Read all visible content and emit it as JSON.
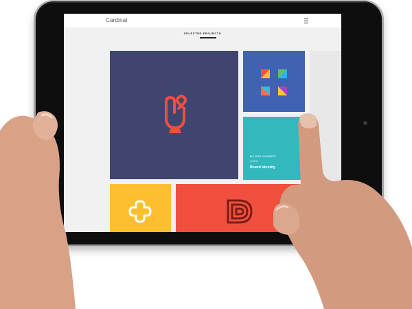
{
  "site": {
    "brand": "Cardinal",
    "menu_icon": "hamburger-menu-icon"
  },
  "section": {
    "title": "SELECTED PROJECTS"
  },
  "projects": [
    {
      "color": "#404570",
      "icon": "lock-logo-icon"
    },
    {
      "color": "#3f63b2",
      "icon": "colorful-tiles-logo-icon"
    },
    {
      "color": "#33b9bd",
      "caption": "W LOGO CONCEPT",
      "title": "Brand Identity"
    },
    {
      "color": "#fcbf2f",
      "icon": "cross-logo-icon"
    },
    {
      "color": "#f04f3e",
      "icon": "dd-monogram-logo-icon"
    }
  ]
}
